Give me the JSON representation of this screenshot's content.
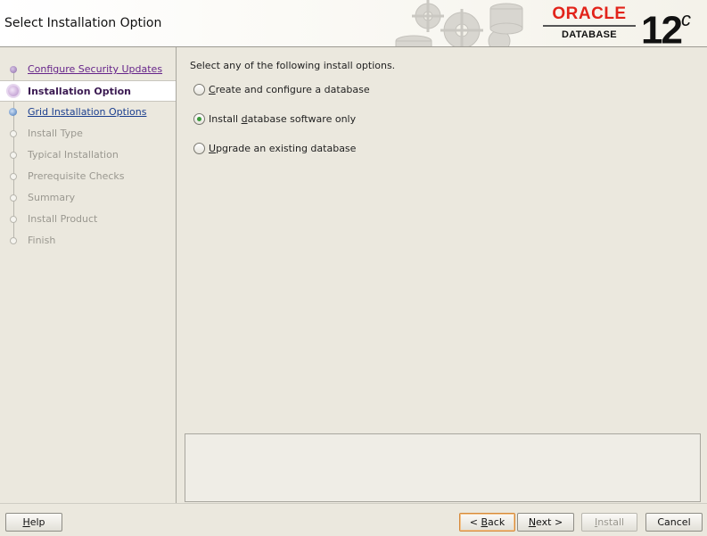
{
  "header": {
    "title": "Select Installation Option",
    "brand": "ORACLE",
    "product": "DATABASE",
    "version": "12",
    "version_suffix": "c"
  },
  "nav": {
    "items": [
      {
        "label": "Configure Security Updates",
        "state": "done"
      },
      {
        "label": "Installation Option",
        "state": "current"
      },
      {
        "label": "Grid Installation Options",
        "state": "next"
      },
      {
        "label": "Install Type",
        "state": "future"
      },
      {
        "label": "Typical Installation",
        "state": "future"
      },
      {
        "label": "Prerequisite Checks",
        "state": "future"
      },
      {
        "label": "Summary",
        "state": "future"
      },
      {
        "label": "Install Product",
        "state": "future"
      },
      {
        "label": "Finish",
        "state": "future"
      }
    ]
  },
  "main": {
    "intro": "Select any of the following install options.",
    "options": [
      {
        "pre": "",
        "mnemonic": "C",
        "post": "reate and configure a database",
        "checked": false
      },
      {
        "pre": "Install ",
        "mnemonic": "d",
        "post": "atabase software only",
        "checked": true
      },
      {
        "pre": "",
        "mnemonic": "U",
        "post": "pgrade an existing database",
        "checked": false
      }
    ]
  },
  "buttons": {
    "help": {
      "mnemonic": "H",
      "rest": "elp"
    },
    "back": {
      "pre": "< ",
      "mnemonic": "B",
      "rest": "ack"
    },
    "next": {
      "mnemonic": "N",
      "rest": "ext >"
    },
    "install": {
      "mnemonic": "I",
      "rest": "nstall"
    },
    "cancel": "Cancel"
  },
  "colors": {
    "oracle_red": "#e2231a",
    "selected_radio": "#3a9a3a",
    "done_step": "#66248a",
    "link_step": "#1b3f8f"
  }
}
